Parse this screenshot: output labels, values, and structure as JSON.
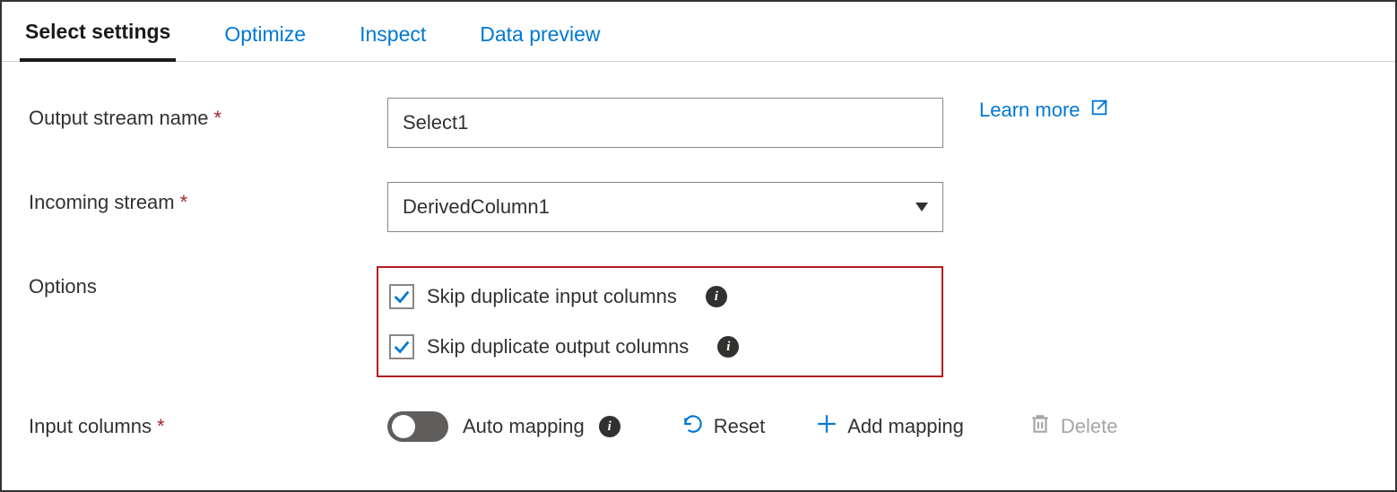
{
  "tabs": {
    "select_settings": "Select settings",
    "optimize": "Optimize",
    "inspect": "Inspect",
    "data_preview": "Data preview"
  },
  "form": {
    "output_stream_label": "Output stream name",
    "output_stream_value": "Select1",
    "incoming_stream_label": "Incoming stream",
    "incoming_stream_value": "DerivedColumn1",
    "options_label": "Options",
    "skip_dup_input": "Skip duplicate input columns",
    "skip_dup_output": "Skip duplicate output columns",
    "input_columns_label": "Input columns",
    "auto_mapping": "Auto mapping",
    "reset": "Reset",
    "add_mapping": "Add mapping",
    "delete": "Delete",
    "learn_more": "Learn more"
  },
  "colors": {
    "accent": "#0078d4",
    "required": "#a4262c",
    "highlight_border": "#b01e1e"
  }
}
